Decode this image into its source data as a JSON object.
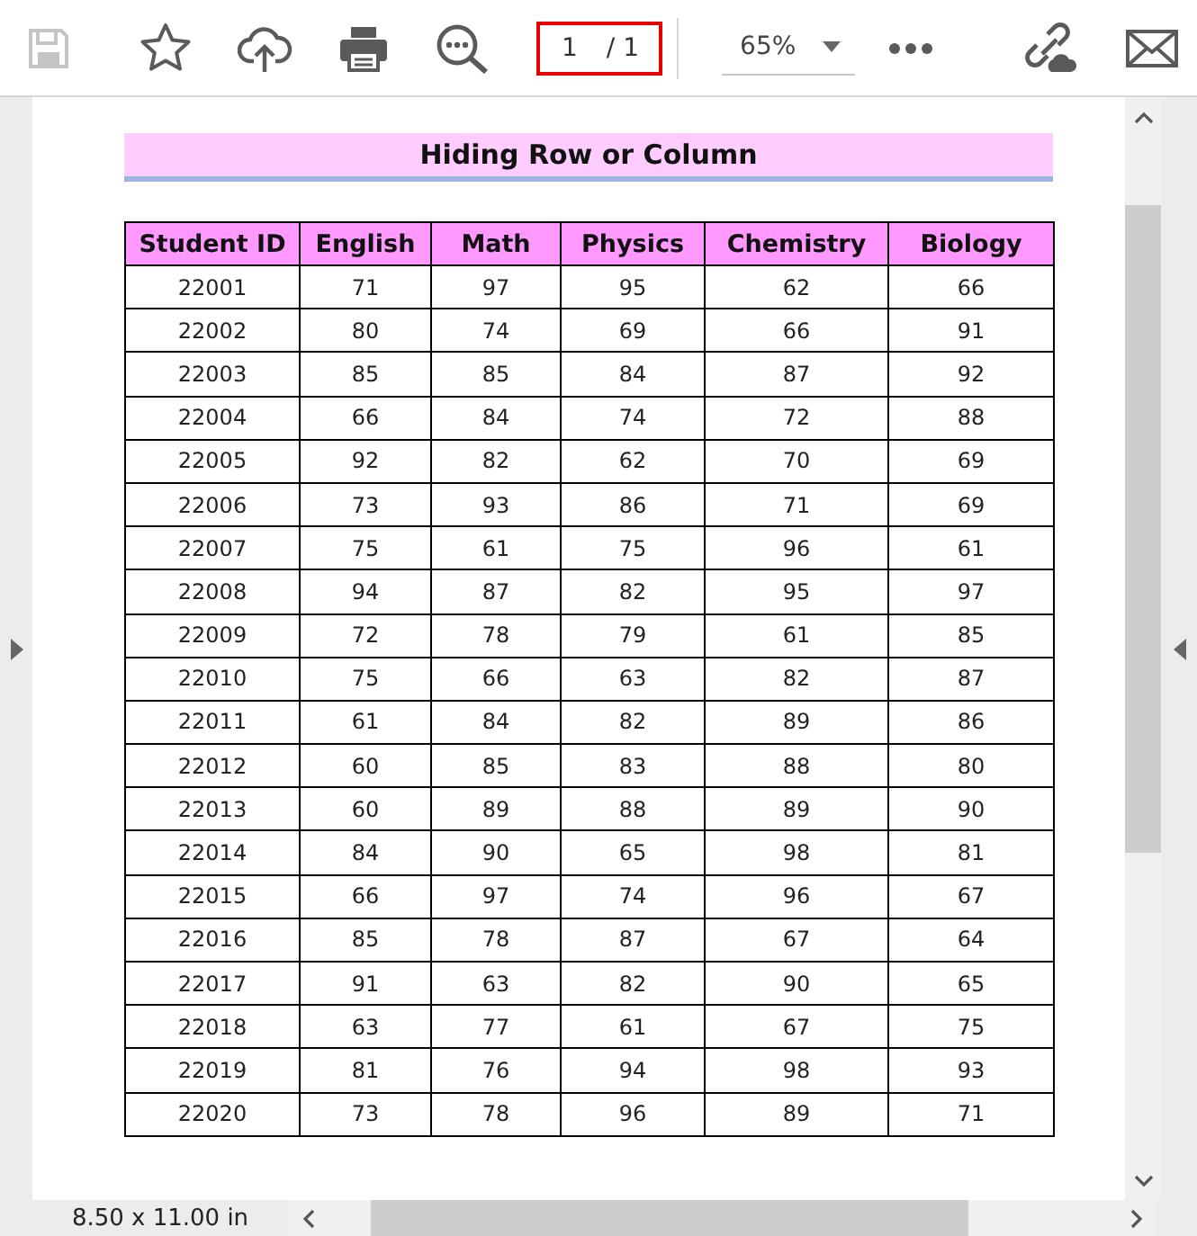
{
  "toolbar": {
    "tools": [
      {
        "kind": "save",
        "disabled": true
      },
      {
        "kind": "bookmark",
        "disabled": false
      },
      {
        "kind": "upload",
        "disabled": false
      },
      {
        "kind": "print",
        "disabled": false
      },
      {
        "kind": "search",
        "disabled": false
      }
    ],
    "page_number": "1",
    "page_total": "/ 1",
    "zoom": "65%",
    "tools_right": [
      {
        "kind": "more",
        "disabled": false
      },
      {
        "kind": "share-link",
        "disabled": false
      },
      {
        "kind": "mail",
        "disabled": false
      }
    ]
  },
  "document": {
    "title": "Hiding Row or Column",
    "table": {
      "columns": [
        "Student ID",
        "English",
        "Math",
        "Physics",
        "Chemistry",
        "Biology"
      ],
      "rows": [
        [
          "22001",
          "71",
          "97",
          "95",
          "62",
          "66"
        ],
        [
          "22002",
          "80",
          "74",
          "69",
          "66",
          "91"
        ],
        [
          "22003",
          "85",
          "85",
          "84",
          "87",
          "92"
        ],
        [
          "22004",
          "66",
          "84",
          "74",
          "72",
          "88"
        ],
        [
          "22005",
          "92",
          "82",
          "62",
          "70",
          "69"
        ],
        [
          "22006",
          "73",
          "93",
          "86",
          "71",
          "69"
        ],
        [
          "22007",
          "75",
          "61",
          "75",
          "96",
          "61"
        ],
        [
          "22008",
          "94",
          "87",
          "82",
          "95",
          "97"
        ],
        [
          "22009",
          "72",
          "78",
          "79",
          "61",
          "85"
        ],
        [
          "22010",
          "75",
          "66",
          "63",
          "82",
          "87"
        ],
        [
          "22011",
          "61",
          "84",
          "82",
          "89",
          "86"
        ],
        [
          "22012",
          "60",
          "85",
          "83",
          "88",
          "80"
        ],
        [
          "22013",
          "60",
          "89",
          "88",
          "89",
          "90"
        ],
        [
          "22014",
          "84",
          "90",
          "65",
          "98",
          "81"
        ],
        [
          "22015",
          "66",
          "97",
          "74",
          "96",
          "67"
        ],
        [
          "22016",
          "85",
          "78",
          "87",
          "67",
          "64"
        ],
        [
          "22017",
          "91",
          "63",
          "82",
          "90",
          "65"
        ],
        [
          "22018",
          "63",
          "77",
          "61",
          "67",
          "75"
        ],
        [
          "22019",
          "81",
          "76",
          "94",
          "98",
          "93"
        ],
        [
          "22020",
          "73",
          "78",
          "96",
          "89",
          "71"
        ]
      ]
    }
  },
  "status_bar": {
    "page_size": "8.50 x 11.00 in"
  }
}
